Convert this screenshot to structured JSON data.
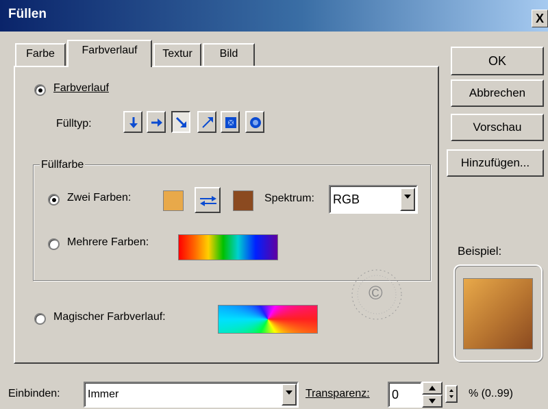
{
  "window": {
    "title": "Füllen",
    "close_label": "X"
  },
  "tabs": [
    {
      "label": "Farbe",
      "active": false
    },
    {
      "label": "Farbverlauf",
      "active": true
    },
    {
      "label": "Textur",
      "active": false
    },
    {
      "label": "Bild",
      "active": false
    }
  ],
  "buttons": {
    "ok": "OK",
    "cancel": "Abbrechen",
    "preview": "Vorschau",
    "add": "Hinzufügen..."
  },
  "gradient": {
    "option_label": "Farbverlauf",
    "selected": true,
    "fill_type_label": "Fülltyp:",
    "fill_types": [
      "down",
      "right",
      "diagonal-down-right",
      "diagonal-up-right",
      "rectangle",
      "circle"
    ],
    "fill_type_selected": "diagonal-down-right"
  },
  "fill_color": {
    "group_label": "Füllfarbe",
    "two_colors_label": "Zwei Farben:",
    "two_colors_selected": true,
    "color1": "#e8a94a",
    "color2": "#8b4a20",
    "spectrum_label": "Spektrum:",
    "spectrum_value": "RGB",
    "multi_colors_label": "Mehrere Farben:",
    "multi_colors_selected": false
  },
  "magic_gradient_label": "Magischer Farbverlauf:",
  "example_label": "Beispiel:",
  "watermark_text": "©",
  "bottom": {
    "embed_label": "Einbinden:",
    "embed_value": "Immer",
    "transparency_label": "Transparenz:",
    "transparency_value": "0",
    "transparency_range": "% (0..99)"
  }
}
